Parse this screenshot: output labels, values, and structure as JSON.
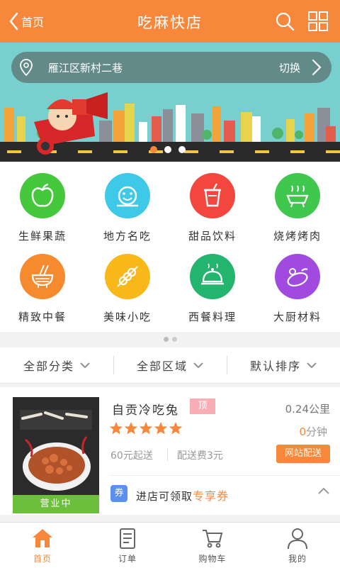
{
  "header": {
    "back_label": "首页",
    "title": "吃麻快店"
  },
  "banner": {
    "address": "雁江区新村二巷",
    "switch_label": "切换",
    "slide_count": 3,
    "active_slide": 1
  },
  "categories": [
    {
      "label": "生鲜果蔬",
      "color": "#46c83d",
      "icon": "apple-icon"
    },
    {
      "label": "地方名吃",
      "color": "#3ec9e8",
      "icon": "smiley-icon"
    },
    {
      "label": "甜品饮料",
      "color": "#f2463f",
      "icon": "cup-icon"
    },
    {
      "label": "烧烤烤肉",
      "color": "#3fc74e",
      "icon": "grill-icon"
    },
    {
      "label": "精致中餐",
      "color": "#f58a2f",
      "icon": "noodle-bowl-icon"
    },
    {
      "label": "美味小吃",
      "color": "#f8b81a",
      "icon": "skewer-icon"
    },
    {
      "label": "西餐料理",
      "color": "#23b46d",
      "icon": "cloche-icon"
    },
    {
      "label": "大厨材料",
      "color": "#a04adf",
      "icon": "eggplant-icon"
    }
  ],
  "filters": [
    {
      "label": "全部分类"
    },
    {
      "label": "全部区域"
    },
    {
      "label": "默认排序"
    }
  ],
  "shop": {
    "name": "自贡冷吃兔",
    "tag": "顶",
    "distance": "0.24公里",
    "rating": 5,
    "minutes": "0",
    "minutes_unit": "分钟",
    "min_order": "60元起送",
    "delivery_fee": "配送费3元",
    "delivery_type": "网站配送",
    "status": "营业中",
    "coupon_badge": "券",
    "coupon_prefix": "进店可领取",
    "coupon_highlight": "专享券"
  },
  "tabs": [
    {
      "label": "首页",
      "active": true
    },
    {
      "label": "订单",
      "active": false
    },
    {
      "label": "购物车",
      "active": false
    },
    {
      "label": "我的",
      "active": false
    }
  ],
  "colors": {
    "accent": "#f7883b",
    "status_green": "#6bbf3a",
    "coupon_blue": "#5b8ff0",
    "tag_pink": "#f9aeb6",
    "star_orange": "#f7883b"
  }
}
